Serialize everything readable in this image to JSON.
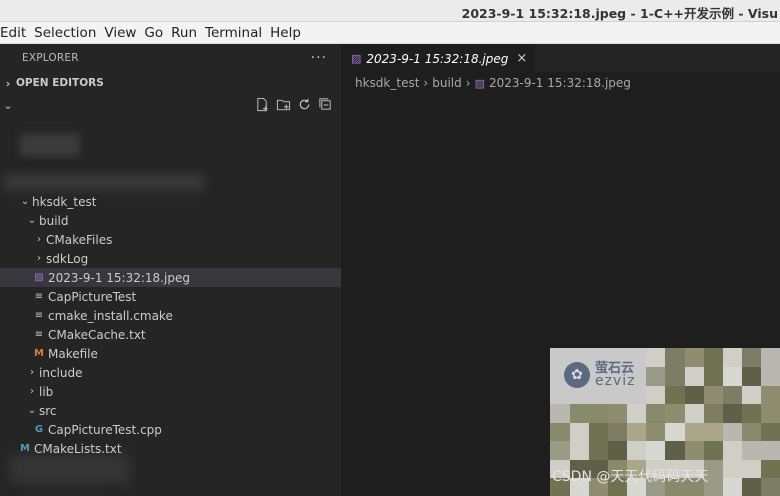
{
  "window": {
    "title": "2023-9-1 15:32:18.jpeg - 1-C++开发示例 - Visu"
  },
  "menubar": {
    "items": [
      "Edit",
      "Selection",
      "View",
      "Go",
      "Run",
      "Terminal",
      "Help"
    ]
  },
  "sidebar": {
    "header": "EXPLORER",
    "more_label": "···",
    "open_editors": "OPEN EDITORS",
    "tree": [
      {
        "label": "hksdk_test",
        "kind": "folder-open",
        "depth": 1
      },
      {
        "label": "build",
        "kind": "folder-open",
        "depth": 2
      },
      {
        "label": "CMakeFiles",
        "kind": "folder",
        "depth": 3
      },
      {
        "label": "sdkLog",
        "kind": "folder",
        "depth": 3
      },
      {
        "label": "2023-9-1 15:32:18.jpeg",
        "kind": "image",
        "depth": 3,
        "selected": true
      },
      {
        "label": "CapPictureTest",
        "kind": "lines",
        "depth": 3
      },
      {
        "label": "cmake_install.cmake",
        "kind": "lines",
        "depth": 3
      },
      {
        "label": "CMakeCache.txt",
        "kind": "lines",
        "depth": 3
      },
      {
        "label": "Makefile",
        "kind": "makefile",
        "depth": 3
      },
      {
        "label": "include",
        "kind": "folder",
        "depth": 2
      },
      {
        "label": "lib",
        "kind": "folder",
        "depth": 2
      },
      {
        "label": "src",
        "kind": "folder-open",
        "depth": 2
      },
      {
        "label": "CapPictureTest.cpp",
        "kind": "cpp",
        "depth": 3
      },
      {
        "label": "CMakeLists.txt",
        "kind": "cmake",
        "depth": 1
      }
    ]
  },
  "editor": {
    "tab_label": "2023-9-1 15:32:18.jpeg",
    "close_label": "×",
    "breadcrumb": [
      "hksdk_test",
      "build",
      "2023-9-1 15:32:18.jpeg"
    ]
  },
  "preview": {
    "logo_cn": "萤石云",
    "logo_en": "ezviz"
  },
  "watermark": "CSDN @天天代码码天天",
  "colors": {
    "accent_purple": "#a074c4",
    "makefile_orange": "#e37933",
    "cmake_blue": "#519aba"
  }
}
